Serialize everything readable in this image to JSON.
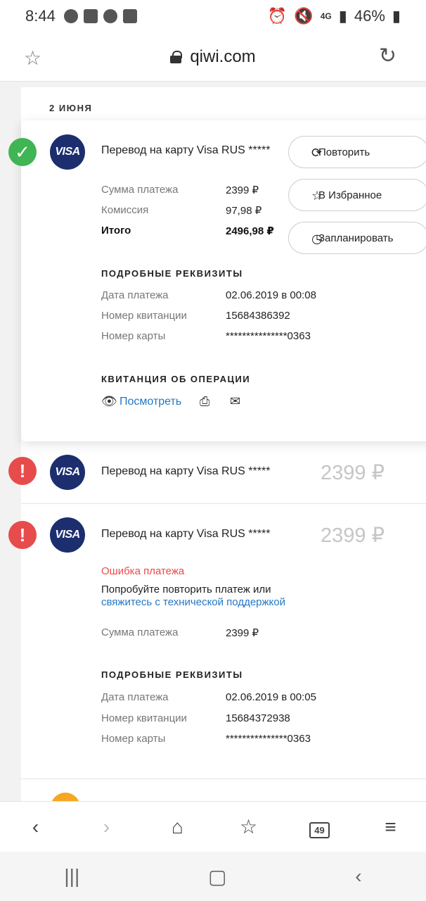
{
  "status_bar": {
    "time": "8:44",
    "battery": "46%",
    "network": "4G"
  },
  "browser": {
    "url": "qiwi.com",
    "tabs_count": "49"
  },
  "history": {
    "date_header": "2 ИЮНЯ",
    "items": [
      {
        "title": "Перевод на карту Visa RUS *****",
        "payment_sum_label": "Сумма платежа",
        "payment_sum_value": "2399 ₽",
        "commission_label": "Комиссия",
        "commission_value": "97,98 ₽",
        "total_label": "Итого",
        "total_value": "2496,98 ₽",
        "details_title": "ПОДРОБНЫЕ РЕКВИЗИТЫ",
        "date_label": "Дата платежа",
        "date_value": "02.06.2019 в 00:08",
        "receipt_label": "Номер квитанции",
        "receipt_value": "15684386392",
        "card_label": "Номер карты",
        "card_value": "***************0363",
        "receipt_section_title": "КВИТАНЦИЯ ОБ ОПЕРАЦИИ",
        "view_link": "Посмотреть",
        "actions": {
          "repeat": "Повторить",
          "favorite": "В Избранное",
          "schedule": "Запланировать"
        }
      },
      {
        "title": "Перевод на карту Visa RUS *****",
        "amount": "2399 ₽"
      },
      {
        "title": "Перевод на карту Visa RUS *****",
        "amount": "2399 ₽",
        "error_title": "Ошибка платежа",
        "error_text": "Попробуйте повторить платеж или",
        "error_link": "свяжитесь с технической поддержкой",
        "payment_sum_label": "Сумма платежа",
        "payment_sum_value": "2399 ₽",
        "details_title": "ПОДРОБНЫЕ РЕКВИЗИТЫ",
        "date_label": "Дата платежа",
        "date_value": "02.06.2019 в 00:05",
        "receipt_label": "Номер квитанции",
        "receipt_value": "15684372938",
        "card_label": "Номер карты",
        "card_value": "***************0363"
      }
    ],
    "visa_text": "VISA"
  }
}
